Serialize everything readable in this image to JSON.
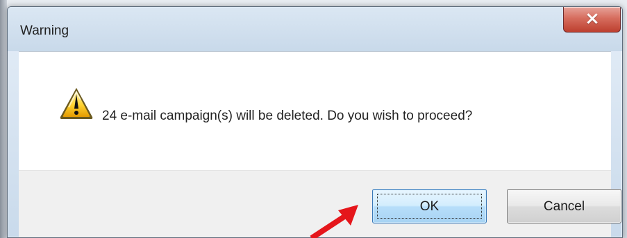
{
  "window": {
    "title": "Warning"
  },
  "dialog": {
    "message": "24 e-mail campaign(s) will be deleted.  Do you wish to proceed?",
    "warning_icon": "warning-icon",
    "ok_label": "OK",
    "cancel_label": "Cancel",
    "close_icon": "close-icon"
  },
  "colors": {
    "title_bar": "#c8d9ea",
    "close_button": "#d66d5e",
    "ok_button": "#b7defa",
    "annotation_arrow": "#e5161b"
  }
}
